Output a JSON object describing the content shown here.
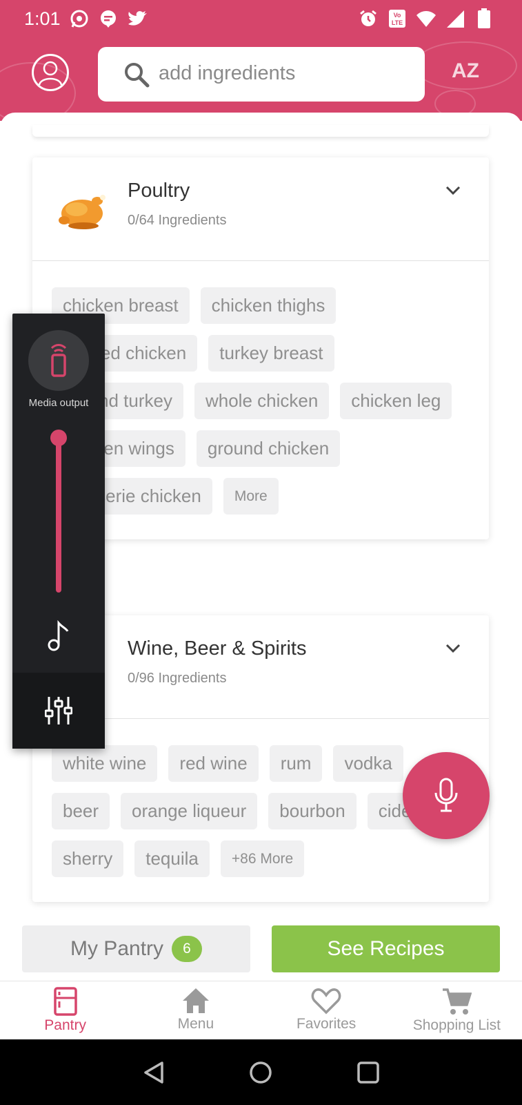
{
  "status_bar": {
    "time": "1:01",
    "left_icons": [
      "whatsapp-icon",
      "chat-icon",
      "twitter-icon"
    ],
    "right_icons": [
      "alarm-icon",
      "volte-icon",
      "wifi-icon",
      "signal-icon",
      "battery-icon"
    ],
    "volte_label": "Vo LTE"
  },
  "header": {
    "search_placeholder": "add ingredients",
    "sort_label": "AZ",
    "brand_color": "#d6456b"
  },
  "categories": [
    {
      "title": "Poultry",
      "subtitle": "0/64 Ingredients",
      "icon": "roast-chicken-icon",
      "chips": [
        "chicken breast",
        "chicken thighs",
        "cooked chicken",
        "turkey breast",
        "ground turkey",
        "whole chicken",
        "chicken leg",
        "chicken wings",
        "ground chicken",
        "rotisserie chicken"
      ],
      "more_label": "More"
    },
    {
      "title": "Wine, Beer & Spirits",
      "subtitle": "0/96 Ingredients",
      "icon": "bottle-icon",
      "chips": [
        "white wine",
        "red wine",
        "rum",
        "vodka",
        "beer",
        "orange liqueur",
        "bourbon",
        "cider",
        "sherry",
        "tequila"
      ],
      "more_label": "+86 More"
    }
  ],
  "media_overlay": {
    "label": "Media output",
    "volume_level": 1.0,
    "accent": "#d6456b"
  },
  "actions": {
    "pantry_label": "My Pantry",
    "pantry_count": "6",
    "recipes_label": "See Recipes",
    "recipes_color": "#8bc34a"
  },
  "bottom_nav": [
    {
      "label": "Pantry",
      "icon": "fridge-icon",
      "active": true
    },
    {
      "label": "Menu",
      "icon": "home-icon",
      "active": false
    },
    {
      "label": "Favorites",
      "icon": "heart-icon",
      "active": false
    },
    {
      "label": "Shopping List",
      "icon": "cart-icon",
      "active": false
    }
  ]
}
